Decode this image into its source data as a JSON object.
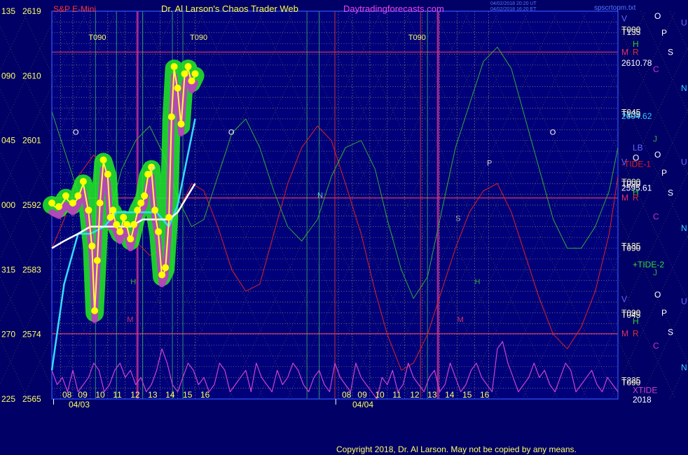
{
  "header": {
    "symbol": "S&P E-Mini",
    "title": "Dr. Al Larson's Chaos Trader Web",
    "website": "Daytradingforecasts.com",
    "timestamp_line1": "04/02/2018 20:20 UT",
    "timestamp_line2": "04/02/2018 16:20 ET",
    "filename": "spscrtopm.txt"
  },
  "footer": {
    "copyright": "Copyright 2018, Dr. Al Larson. May not be copied by any means."
  },
  "colors": {
    "background": "#000066",
    "plot_background": "#00007a",
    "price": "#ffff33",
    "green_glow": "#22ee22",
    "magenta": "#cc33cc",
    "white_ma": "#ffffff",
    "cyan_ma": "#33ddff",
    "red_tide": "#dd2222",
    "green_tide": "#33aa33",
    "xtide": "#cc44cc",
    "grid": "#ffff66",
    "date_line": "#cc3366"
  },
  "chart_data": {
    "type": "line",
    "title": "S&P E-Mini",
    "ylim": [
      2565,
      2619
    ],
    "y_ticks": [
      {
        "angle": "135",
        "price": "2619"
      },
      {
        "angle": "090",
        "price": "2610"
      },
      {
        "angle": "045",
        "price": "2601"
      },
      {
        "angle": "000",
        "price": "2592"
      },
      {
        "angle": "315",
        "price": "2583"
      },
      {
        "angle": "270",
        "price": "2574"
      },
      {
        "angle": "225",
        "price": "2565"
      }
    ],
    "x_hour_ticks": [
      "08",
      "09",
      "10",
      "11",
      "12",
      "13",
      "14",
      "15",
      "16",
      "08",
      "09",
      "10",
      "11",
      "12",
      "13",
      "14",
      "15",
      "16"
    ],
    "x_dates": [
      "04/03",
      "04/04"
    ],
    "x_range_hours": [
      7.8,
      40.2
    ],
    "grid": true,
    "series": [
      {
        "kind": "price",
        "x": [
          7.8,
          8.2,
          8.6,
          9,
          9.3,
          9.6,
          9.9,
          10.1,
          10.25,
          10.4,
          10.55,
          10.75,
          11,
          11.15,
          11.3,
          11.5,
          11.7,
          11.9,
          12.1,
          12.3,
          12.5,
          12.7,
          12.9,
          13.1,
          13.3,
          13.5,
          13.7,
          13.9,
          14.1,
          14.3,
          14.5,
          14.65,
          14.8,
          15,
          15.2,
          15.4,
          15.6,
          15.8,
          16
        ],
        "y": [
          2592,
          2591.5,
          2593,
          2592,
          2593,
          2595,
          2591,
          2586,
          2577,
          2584,
          2592,
          2598,
          2596,
          2590,
          2591,
          2589,
          2588,
          2590,
          2589,
          2587,
          2589,
          2591,
          2592,
          2593,
          2596,
          2597,
          2591,
          2588,
          2582,
          2583,
          2590,
          2604,
          2611,
          2608,
          2603,
          2610,
          2611,
          2609,
          2610
        ]
      },
      {
        "kind": "cyan_ma",
        "x": [
          7.8,
          8.5,
          9.3,
          10,
          10.8,
          11.5,
          12.3,
          13,
          13.8,
          14.5,
          15,
          15.5,
          16
        ],
        "y": [
          2569,
          2581,
          2588,
          2588,
          2589,
          2591,
          2591,
          2591,
          2591,
          2589,
          2592,
          2598,
          2604
        ]
      },
      {
        "kind": "white_ma",
        "x": [
          7.8,
          8.5,
          9.3,
          10,
          10.8,
          11.5,
          12.3,
          13,
          13.8,
          14.5,
          15,
          15.5,
          16
        ],
        "y": [
          2586,
          2587,
          2588,
          2589,
          2589,
          2589,
          2589,
          2590,
          2590,
          2590,
          2591,
          2593,
          2595
        ]
      },
      {
        "kind": "red_tide_1",
        "x": [
          7.8,
          8.5,
          9.3,
          10.2,
          11,
          11.8,
          12.6,
          13.4,
          14.2,
          15,
          15.8,
          16.5,
          17.3,
          18.1,
          18.9,
          19.7,
          20.5,
          21.3,
          22.1,
          23,
          23.8,
          24.6,
          25.5,
          26.3,
          27,
          27.8,
          28.5,
          29.3,
          30.1,
          30.9,
          31.7,
          32.5,
          33.3,
          34.1,
          34.9,
          35.7,
          36.5,
          37.3,
          38.1,
          38.9,
          39.7,
          40.2
        ],
        "y": [
          2586,
          2590,
          2596,
          2599,
          2596,
          2590,
          2587,
          2585,
          2586,
          2591,
          2595,
          2594,
          2589,
          2583,
          2580,
          2581,
          2588,
          2595,
          2600,
          2603,
          2601,
          2595,
          2588,
          2580,
          2574,
          2569,
          2570,
          2574,
          2580,
          2586,
          2591,
          2594,
          2595,
          2591,
          2585,
          2579,
          2574,
          2572,
          2575,
          2580,
          2588,
          2596
        ]
      },
      {
        "kind": "green_tide_2",
        "x": [
          7.8,
          8.6,
          9.4,
          10.2,
          11,
          11.8,
          12.6,
          13.4,
          14.2,
          15,
          15.8,
          16.5,
          17.3,
          18.1,
          18.9,
          19.7,
          20.5,
          21.3,
          22.1,
          23,
          23.8,
          24.6,
          25.5,
          26.3,
          27,
          27.8,
          28.5,
          29.3,
          30.1,
          30.9,
          31.7,
          32.5,
          33.3,
          34.1,
          34.9,
          35.7,
          36.5,
          37.3,
          38.1,
          38.9,
          39.7,
          40.2
        ],
        "y": [
          2605,
          2599,
          2593,
          2588,
          2590,
          2597,
          2601,
          2603,
          2599,
          2593,
          2589,
          2590,
          2596,
          2602,
          2604,
          2600,
          2594,
          2589,
          2587,
          2590,
          2596,
          2600,
          2601,
          2597,
          2590,
          2583,
          2579,
          2582,
          2591,
          2600,
          2606,
          2612,
          2614,
          2611,
          2604,
          2597,
          2590,
          2586,
          2586,
          2589,
          2594,
          2600
        ]
      },
      {
        "kind": "xtide",
        "x": [
          7.8,
          8.1,
          8.4,
          8.7,
          9,
          9.3,
          9.6,
          9.9,
          10.2,
          10.5,
          10.8,
          11.1,
          11.4,
          11.7,
          12,
          12.3,
          12.6,
          12.9,
          13.2,
          13.5,
          13.8,
          14.1,
          14.4,
          14.7,
          15,
          15.3,
          15.6,
          15.9,
          16.2,
          16.5,
          16.8,
          17.1,
          17.4,
          17.7,
          18,
          18.3,
          18.6,
          18.9,
          19.2,
          19.5,
          19.8,
          20.1,
          20.4,
          20.7,
          21,
          21.3,
          21.6,
          21.9,
          22.2,
          22.5,
          22.8,
          23.1,
          23.4,
          23.7,
          24,
          24.3,
          24.6,
          24.9,
          25.2,
          25.5,
          25.8,
          26.1,
          26.4,
          26.7,
          27,
          27.3,
          27.6,
          27.9,
          28.2,
          28.5,
          28.8,
          29.1,
          29.4,
          29.7,
          30,
          30.3,
          30.6,
          30.9,
          31.2,
          31.5,
          31.8,
          32.1,
          32.4,
          32.7,
          33,
          33.3,
          33.6,
          33.9,
          34.2,
          34.5,
          34.8,
          35.1,
          35.4,
          35.7,
          36,
          36.3,
          36.6,
          36.9,
          37.2,
          37.5,
          37.8,
          38.1,
          38.4,
          38.7,
          39,
          39.3,
          39.6,
          39.9,
          40.2
        ],
        "y": [
          2569,
          2567,
          2568,
          2566,
          2569,
          2566,
          2567,
          2568,
          2570,
          2569,
          2566,
          2567,
          2569,
          2570,
          2568,
          2569,
          2567,
          2568,
          2566,
          2567,
          2569,
          2572,
          2570,
          2567,
          2566,
          2568,
          2570,
          2569,
          2567,
          2568,
          2566,
          2567,
          2570,
          2569,
          2566,
          2567,
          2568,
          2569,
          2566,
          2570,
          2568,
          2567,
          2566,
          2569,
          2567,
          2568,
          2570,
          2569,
          2567,
          2566,
          2568,
          2569,
          2567,
          2566,
          2570,
          2568,
          2567,
          2566,
          2570,
          2568,
          2567,
          2566,
          2565,
          2568,
          2567,
          2569,
          2566,
          2567,
          2570,
          2568,
          2567,
          2566,
          2568,
          2569,
          2566,
          2567,
          2570,
          2568,
          2566,
          2567,
          2569,
          2570,
          2568,
          2567,
          2566,
          2572,
          2573,
          2570,
          2568,
          2566,
          2567,
          2568,
          2570,
          2568,
          2569,
          2567,
          2566,
          2568,
          2570,
          2569,
          2566,
          2567,
          2568,
          2569,
          2567,
          2566,
          2568,
          2567,
          2566
        ]
      }
    ]
  },
  "annotations": {
    "top_labels": [
      {
        "text": "T090",
        "x": 9.9,
        "y": 2615.0
      },
      {
        "text": "T090",
        "x": 15.7,
        "y": 2615.0
      },
      {
        "text": "T090",
        "x": 28.2,
        "y": 2615.0
      }
    ],
    "o_labels": [
      {
        "text": "O",
        "x": 9.0,
        "y": 2601.8
      },
      {
        "text": "O",
        "x": 17.9,
        "y": 2601.8
      },
      {
        "text": "O",
        "x": 36.3,
        "y": 2601.8
      }
    ],
    "mid_labels": [
      {
        "text": "P",
        "x": 13.45,
        "y": 2596.7,
        "color": "#cccccc"
      },
      {
        "text": "N",
        "x": 23.0,
        "y": 2593.0,
        "color": "#66cccc"
      },
      {
        "text": "P",
        "x": 32.7,
        "y": 2597.5,
        "color": "#cccccc"
      },
      {
        "text": "S",
        "x": 30.9,
        "y": 2589.8,
        "color": "#aaaaaa"
      },
      {
        "text": "H",
        "x": 12.3,
        "y": 2581.0,
        "color": "#33aa33"
      },
      {
        "text": "H",
        "x": 32.0,
        "y": 2581.0,
        "color": "#33aa33"
      },
      {
        "text": "M",
        "x": 12.1,
        "y": 2575.7,
        "color": "#cc3366"
      },
      {
        "text": "M",
        "x": 31.0,
        "y": 2575.7,
        "color": "#cc3366"
      }
    ],
    "right_labels": [
      {
        "text": "V",
        "color": "#6666ff",
        "col": 0,
        "y": 2618.0
      },
      {
        "text": "T000",
        "color": "#ffffcc",
        "col": 0,
        "y": 2616.4
      },
      {
        "text": "T135",
        "color": "#ffffcc",
        "col": 0,
        "y": 2616.1
      },
      {
        "text": "H",
        "color": "#33cc33",
        "col": 1,
        "y": 2614.4
      },
      {
        "text": "M",
        "color": "#dd3366",
        "col": 0,
        "y": 2613.3
      },
      {
        "text": "R",
        "color": "#dd3333",
        "col": 1,
        "y": 2613.3
      },
      {
        "text": "2610.78",
        "color": "#ffffff",
        "col": 0,
        "y": 2611.8
      },
      {
        "text": "C",
        "color": "#cc33cc",
        "col": 2,
        "y": 2610.9
      },
      {
        "text": "T045",
        "color": "#ffffcc",
        "col": 0,
        "y": 2604.9
      },
      {
        "text": "T135",
        "color": "#ffffcc",
        "col": 0,
        "y": 2604.6
      },
      {
        "text": "2604.62",
        "color": "#33ccff",
        "col": 0,
        "y": 2604.4
      },
      {
        "text": "J",
        "color": "#33aa33",
        "col": 2,
        "y": 2601.2
      },
      {
        "text": "LB",
        "color": "#6666ff",
        "col": 1,
        "y": 2600.0
      },
      {
        "text": "O",
        "color": "#ffffff",
        "col": 1,
        "y": 2598.6
      },
      {
        "text": "V",
        "color": "#6666ff",
        "col": 0,
        "y": 2598.0
      },
      {
        "text": "-TIDE-1",
        "color": "#dd2222",
        "col": 0,
        "y": 2597.7
      },
      {
        "text": "T000",
        "color": "#ffffcc",
        "col": 0,
        "y": 2595.2
      },
      {
        "text": "T090",
        "color": "#ffffcc",
        "col": 0,
        "y": 2594.9
      },
      {
        "text": "2595.61",
        "color": "#ffffff",
        "col": 0,
        "y": 2594.4
      },
      {
        "text": "H",
        "color": "#33cc33",
        "col": 1,
        "y": 2593.8
      },
      {
        "text": "M",
        "color": "#dd3366",
        "col": 0,
        "y": 2593.0
      },
      {
        "text": "R",
        "color": "#dd3333",
        "col": 1,
        "y": 2593.0
      },
      {
        "text": "C",
        "color": "#cc33cc",
        "col": 2,
        "y": 2590.4
      },
      {
        "text": "T135",
        "color": "#ffffcc",
        "col": 0,
        "y": 2586.3
      },
      {
        "text": "T090",
        "color": "#ffffcc",
        "col": 0,
        "y": 2586.0
      },
      {
        "text": "+TIDE-2",
        "color": "#33dd33",
        "col": 1,
        "y": 2583.7
      },
      {
        "text": "J",
        "color": "#33aa33",
        "col": 2,
        "y": 2582.6
      },
      {
        "text": "V",
        "color": "#6666ff",
        "col": 0,
        "y": 2578.9
      },
      {
        "text": "T090",
        "color": "#ffffcc",
        "col": 0,
        "y": 2577.0
      },
      {
        "text": "T045",
        "color": "#ffffcc",
        "col": 0,
        "y": 2576.7
      },
      {
        "text": "H",
        "color": "#33cc33",
        "col": 1,
        "y": 2575.8
      },
      {
        "text": "M",
        "color": "#dd3366",
        "col": 0,
        "y": 2574.1
      },
      {
        "text": "R",
        "color": "#dd3333",
        "col": 1,
        "y": 2574.1
      },
      {
        "text": "C",
        "color": "#cc33cc",
        "col": 2,
        "y": 2572.4
      },
      {
        "text": "T225",
        "color": "#ffffcc",
        "col": 0,
        "y": 2567.6
      },
      {
        "text": "T090",
        "color": "#ffffcc",
        "col": 0,
        "y": 2567.3
      },
      {
        "text": "XTIDE",
        "color": "#cc44cc",
        "col": 1,
        "y": 2566.2
      },
      {
        "text": "2018",
        "color": "#ffffff",
        "col": 1,
        "y": 2564.9
      }
    ],
    "far_right_letters": [
      {
        "text": "O",
        "color": "#ffffff",
        "col": 0,
        "y": 2618.3
      },
      {
        "text": "U",
        "color": "#6666ff",
        "col": 3,
        "y": 2617.4
      },
      {
        "text": "P",
        "color": "#ffffff",
        "col": 1,
        "y": 2616.0
      },
      {
        "text": "S",
        "color": "#ffffff",
        "col": 2,
        "y": 2613.3
      },
      {
        "text": "N",
        "color": "#33ccff",
        "col": 3,
        "y": 2608.3
      },
      {
        "text": "O",
        "color": "#ffffff",
        "col": 0,
        "y": 2599.0
      },
      {
        "text": "U",
        "color": "#6666ff",
        "col": 3,
        "y": 2598.0
      },
      {
        "text": "P",
        "color": "#ffffff",
        "col": 1,
        "y": 2596.5
      },
      {
        "text": "S",
        "color": "#ffffff",
        "col": 2,
        "y": 2593.7
      },
      {
        "text": "N",
        "color": "#33ccff",
        "col": 3,
        "y": 2588.8
      },
      {
        "text": "O",
        "color": "#ffffff",
        "col": 0,
        "y": 2579.5
      },
      {
        "text": "U",
        "color": "#6666ff",
        "col": 3,
        "y": 2578.6
      },
      {
        "text": "P",
        "color": "#ffffff",
        "col": 1,
        "y": 2577.0
      },
      {
        "text": "S",
        "color": "#ffffff",
        "col": 2,
        "y": 2574.3
      },
      {
        "text": "N",
        "color": "#33ccff",
        "col": 3,
        "y": 2569.4
      }
    ]
  }
}
